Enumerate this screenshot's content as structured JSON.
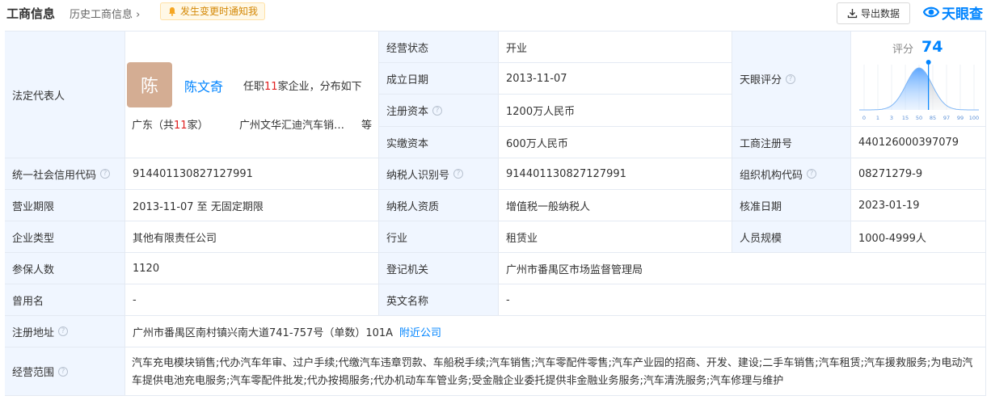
{
  "header": {
    "title": "工商信息",
    "history_link": "历史工商信息",
    "notify_label": "发生变更时通知我",
    "export_label": "导出数据",
    "brand_name": "天眼查"
  },
  "legal_rep": {
    "label": "法定代表人",
    "avatar_char": "陈",
    "name": "陈文奇",
    "info_prefix": "任职",
    "count": "11",
    "info_suffix": "家企业，分布如下",
    "region_prefix": "广东（共",
    "region_count": "11",
    "region_suffix": "家）",
    "company": "广州文华汇迪汽车销…",
    "etc": "等"
  },
  "fields": {
    "status_label": "经营状态",
    "status_value": "开业",
    "founded_label": "成立日期",
    "founded_value": "2013-11-07",
    "reg_capital_label": "注册资本",
    "reg_capital_value": "1200万人民币",
    "paid_capital_label": "实缴资本",
    "paid_capital_value": "600万人民币",
    "tianyan_label": "天眼评分",
    "reg_no_label": "工商注册号",
    "reg_no_value": "440126000397079",
    "credit_code_label": "统一社会信用代码",
    "credit_code_value": "914401130827127991",
    "taxpayer_id_label": "纳税人识别号",
    "taxpayer_id_value": "914401130827127991",
    "org_code_label": "组织机构代码",
    "org_code_value": "08271279-9",
    "term_label": "营业期限",
    "term_value": "2013-11-07 至 无固定期限",
    "taxpayer_qual_label": "纳税人资质",
    "taxpayer_qual_value": "增值税一般纳税人",
    "approve_label": "核准日期",
    "approve_value": "2023-01-19",
    "type_label": "企业类型",
    "type_value": "其他有限责任公司",
    "industry_label": "行业",
    "industry_value": "租赁业",
    "staff_label": "人员规模",
    "staff_value": "1000-4999人",
    "insured_label": "参保人数",
    "insured_value": "1120",
    "authority_label": "登记机关",
    "authority_value": "广州市番禺区市场监督管理局",
    "former_name_label": "曾用名",
    "former_name_value": "-",
    "english_label": "英文名称",
    "english_value": "-",
    "address_label": "注册地址",
    "address_value": "广州市番禺区南村镇兴南大道741-757号（单数）101A",
    "nearby_link": "附近公司",
    "scope_label": "经营范围",
    "scope_value": "汽车充电模块销售;代办汽车年审、过户手续;代缴汽车违章罚款、车船税手续;汽车销售;汽车零配件零售;汽车产业园的招商、开发、建设;二手车销售;汽车租赁;汽车援救服务;为电动汽车提供电池充电服务;汽车零配件批发;代办按揭服务;代办机动车车管业务;受金融企业委托提供非金融业务服务;汽车清洗服务;汽车修理与维护"
  },
  "score": {
    "label": "评分",
    "value": "74",
    "value_num": 74,
    "ticks": [
      "0",
      "1",
      "3",
      "15",
      "50",
      "85",
      "97",
      "99",
      "100"
    ],
    "accent": "#0084ff"
  }
}
